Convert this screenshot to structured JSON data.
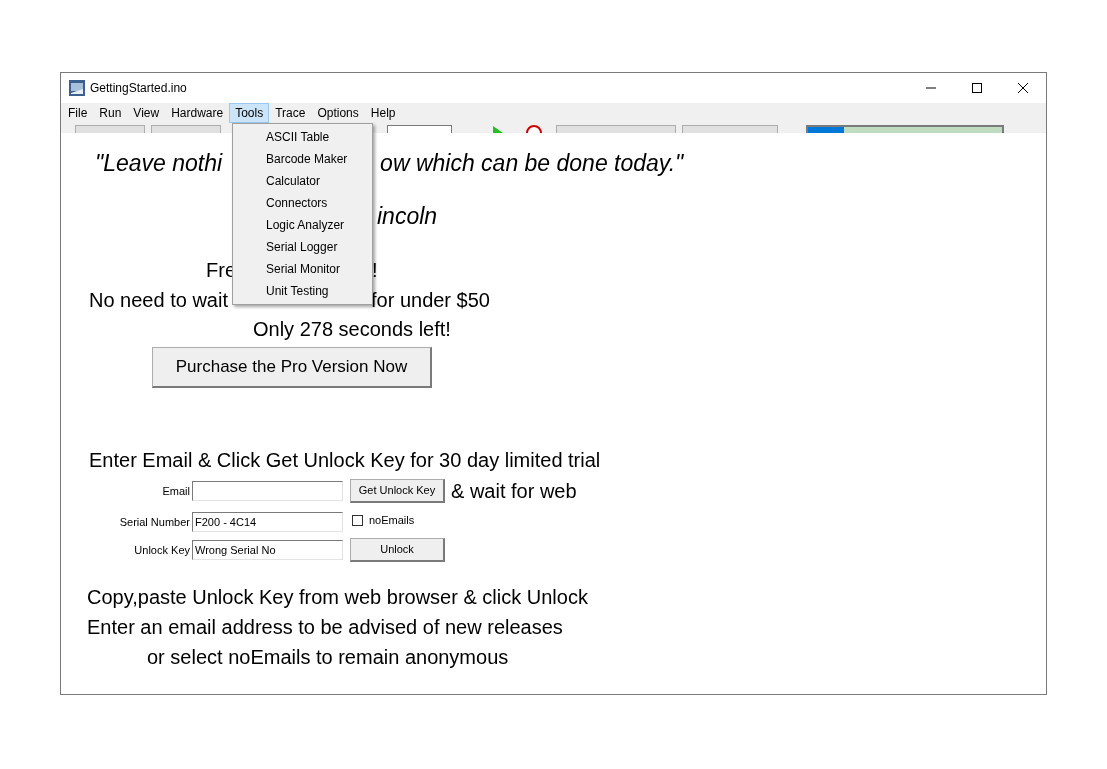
{
  "window": {
    "title": "GettingStarted.ino"
  },
  "menu_bar": [
    {
      "label": "File",
      "selected": false
    },
    {
      "label": "Run",
      "selected": false
    },
    {
      "label": "View",
      "selected": false
    },
    {
      "label": "Hardware",
      "selected": false
    },
    {
      "label": "Tools",
      "selected": true
    },
    {
      "label": "Trace",
      "selected": false
    },
    {
      "label": "Options",
      "selected": false
    },
    {
      "label": "Help",
      "selected": false
    }
  ],
  "tools_menu": [
    "ASCII Table",
    "Barcode Maker",
    "Calculator",
    "Connectors",
    "Logic Analyzer",
    "Serial Logger",
    "Serial Monitor",
    "Unit Testing"
  ],
  "quote": {
    "left": "\"Leave nothi",
    "right": "ow which can be done today.\"",
    "author": "incoln"
  },
  "promo": {
    "line1_left": "Fre",
    "line1_right": "!",
    "line2_left": "No need to wait",
    "line2_right": "for under $50",
    "countdown": "Only 278 seconds left!",
    "button": "Purchase the Pro Version Now"
  },
  "trial": {
    "heading": "Enter Email & Click Get Unlock Key for 30 day limited trial",
    "email_label": "Email",
    "get_key_button": "Get Unlock Key",
    "wait_note": "& wait for web",
    "serial_label": "Serial Number",
    "serial_value": "F200 - 4C14",
    "no_emails": {
      "label": "noEmails",
      "checked": false
    },
    "unlock_label": "Unlock Key",
    "unlock_value": "Wrong Serial No",
    "unlock_button": "Unlock"
  },
  "instructions": [
    "Copy,paste Unlock Key from web browser & click Unlock",
    "Enter an email address to be advised of new releases",
    "or select noEmails to remain anonymous"
  ]
}
